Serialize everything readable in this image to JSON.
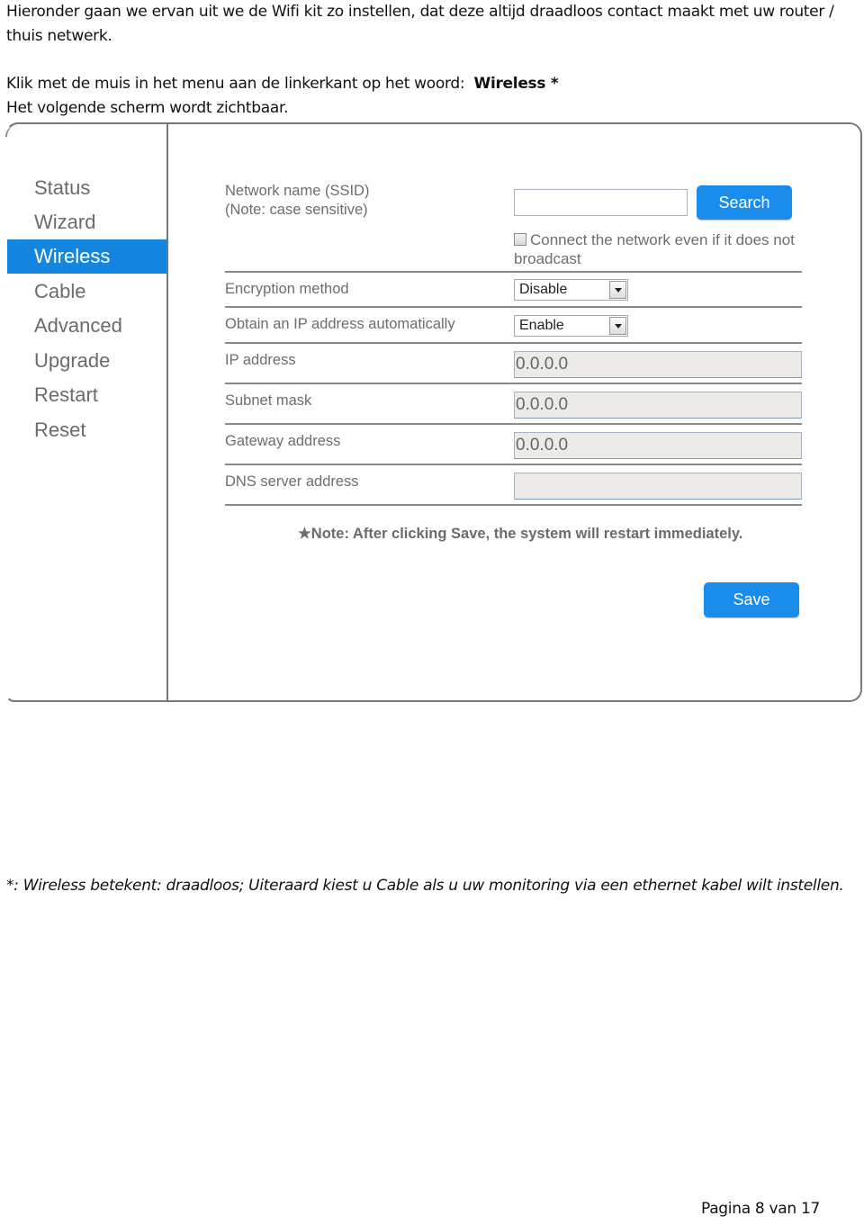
{
  "document": {
    "intro": "Hieronder gaan we ervan uit we de Wifi kit zo instellen, dat deze altijd draadloos contact maakt met uw router / thuis netwerk.",
    "instruction_prefix": "Klik met de muis in het menu aan de linkerkant op het woord:",
    "instruction_keyword": "Wireless *",
    "instruction_line2": "Het volgende scherm wordt zichtbaar.",
    "footnote": "*: Wireless betekent: draadloos; Uiteraard kiest u Cable als u uw monitoring via een ethernet kabel wilt instellen.",
    "page_number": "Pagina 8 van 17"
  },
  "screenshot": {
    "sidebar": {
      "items": [
        {
          "label": "Status",
          "active": false
        },
        {
          "label": "Wizard",
          "active": false
        },
        {
          "label": "Wireless",
          "active": true
        },
        {
          "label": "Cable",
          "active": false
        },
        {
          "label": "Advanced",
          "active": false
        },
        {
          "label": "Upgrade",
          "active": false
        },
        {
          "label": "Restart",
          "active": false
        },
        {
          "label": "Reset",
          "active": false
        }
      ]
    },
    "form": {
      "ssid_label": "Network name (SSID)",
      "ssid_note": "(Note: case sensitive)",
      "ssid_value": "",
      "search_label": "Search",
      "broadcast_label": "Connect the network even if it does not broadcast",
      "broadcast_checked": false,
      "encryption_label": "Encryption method",
      "encryption_value": "Disable",
      "dhcp_label": "Obtain an IP address automatically",
      "dhcp_value": "Enable",
      "ip_label": "IP address",
      "ip_value": "0.0.0.0",
      "subnet_label": "Subnet mask",
      "subnet_value": "0.0.0.0",
      "gateway_label": "Gateway address",
      "gateway_value": "0.0.0.0",
      "dns_label": "DNS server address",
      "dns_value": "",
      "note": "★Note: After clicking Save, the system will restart immediately.",
      "save_label": "Save"
    },
    "colors": {
      "accent": "#1a8ceb",
      "active_nav": "#1486e0",
      "label_gray": "#6d6d6d",
      "readonly_bg": "#ecebe8"
    }
  }
}
